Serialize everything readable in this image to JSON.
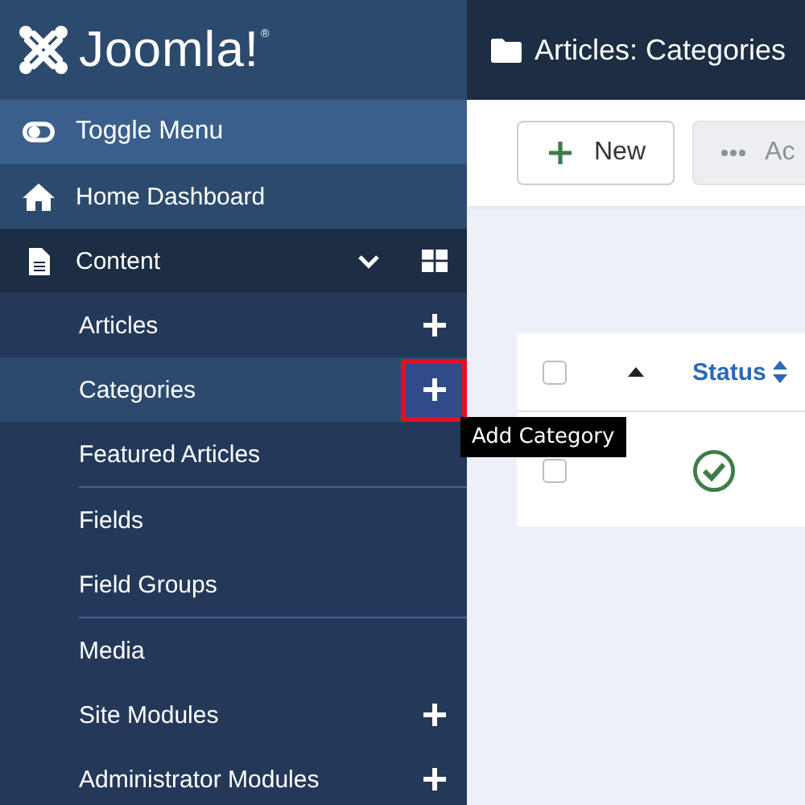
{
  "logo": {
    "text": "Joomla!",
    "mark": "®"
  },
  "sidebar": {
    "toggle": "Toggle Menu",
    "items": [
      {
        "kind": "home",
        "label": "Home Dashboard"
      },
      {
        "kind": "section",
        "label": "Content",
        "expanded": true,
        "groups": [
          {
            "items": [
              {
                "label": "Articles",
                "add": true,
                "selected": false
              },
              {
                "label": "Categories",
                "add": true,
                "selected": true,
                "focused": true,
                "tooltip": "Add Category"
              },
              {
                "label": "Featured Articles",
                "selected": false
              }
            ]
          },
          {
            "items": [
              {
                "label": "Fields",
                "selected": false
              },
              {
                "label": "Field Groups",
                "selected": false
              }
            ]
          },
          {
            "items": [
              {
                "label": "Media",
                "selected": false
              },
              {
                "label": "Site Modules",
                "add": true,
                "selected": false
              },
              {
                "label": "Administrator Modules",
                "add": true,
                "selected": false
              }
            ]
          }
        ]
      }
    ]
  },
  "page_title": "Articles: Categories",
  "toolbar": [
    {
      "kind": "new",
      "label": "New",
      "disabled": false
    },
    {
      "kind": "actions",
      "label": "Ac",
      "disabled": true
    }
  ],
  "table": {
    "columns": [
      {
        "kind": "checkbox",
        "checked": false
      },
      {
        "kind": "order"
      },
      {
        "kind": "sortable",
        "label": "Status"
      }
    ],
    "rows": [
      {
        "checked": false,
        "published": true
      }
    ]
  }
}
